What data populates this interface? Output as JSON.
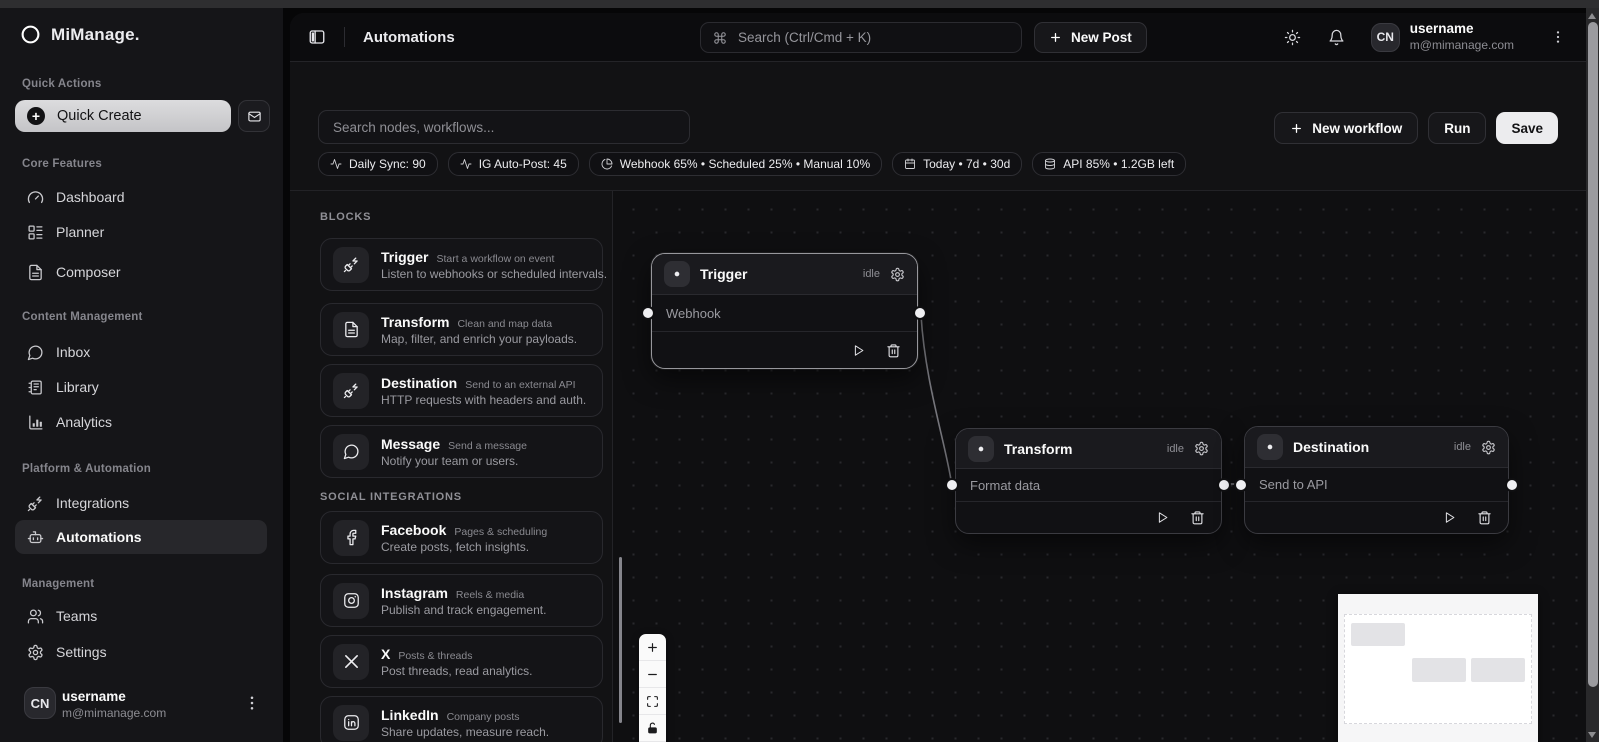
{
  "sidebar": {
    "logo_text": "MiManage.",
    "sections": {
      "quick_actions": "Quick Actions",
      "core_features": "Core Features",
      "content_management": "Content Management",
      "platform_automation": "Platform & Automation",
      "management": "Management"
    },
    "quick_create_label": "Quick Create",
    "items": {
      "dashboard": "Dashboard",
      "planner": "Planner",
      "composer": "Composer",
      "inbox": "Inbox",
      "library": "Library",
      "analytics": "Analytics",
      "integrations": "Integrations",
      "automations": "Automations",
      "teams": "Teams",
      "settings": "Settings"
    },
    "user": {
      "initials": "CN",
      "name": "username",
      "email": "m@mimanage.com"
    }
  },
  "header": {
    "title": "Automations",
    "search_placeholder": "Search (Ctrl/Cmd + K)",
    "new_post_label": "New Post",
    "user": {
      "initials": "CN",
      "name": "username",
      "email": "m@mimanage.com"
    }
  },
  "toolbar": {
    "search_placeholder": "Search nodes, workflows...",
    "badges": [
      {
        "icon": "activity-icon",
        "label": "Daily Sync: 90"
      },
      {
        "icon": "activity-icon",
        "label": "IG Auto-Post: 45"
      },
      {
        "icon": "pie-chart-icon",
        "label": "Webhook 65% • Scheduled 25% • Manual 10%"
      },
      {
        "icon": "calendar-icon",
        "label": "Today • 7d • 30d"
      },
      {
        "icon": "database-icon",
        "label": "API 85% • 1.2GB left"
      }
    ],
    "new_workflow_label": "New workflow",
    "run_label": "Run",
    "save_label": "Save"
  },
  "blocks_panel": {
    "blocks_heading": "BLOCKS",
    "social_heading": "SOCIAL INTEGRATIONS",
    "blocks": [
      {
        "icon": "plug-icon",
        "title": "Trigger",
        "subtitle": "Start a workflow on event",
        "description": "Listen to webhooks or scheduled intervals."
      },
      {
        "icon": "file-text-icon",
        "title": "Transform",
        "subtitle": "Clean and map data",
        "description": "Map, filter, and enrich your payloads."
      },
      {
        "icon": "plug-icon",
        "title": "Destination",
        "subtitle": "Send to an external API",
        "description": "HTTP requests with headers and auth."
      },
      {
        "icon": "message-circle-icon",
        "title": "Message",
        "subtitle": "Send a message",
        "description": "Notify your team or users."
      }
    ],
    "social": [
      {
        "icon": "facebook-icon",
        "title": "Facebook",
        "subtitle": "Pages & scheduling",
        "description": "Create posts, fetch insights."
      },
      {
        "icon": "instagram-icon",
        "title": "Instagram",
        "subtitle": "Reels & media",
        "description": "Publish and track engagement."
      },
      {
        "icon": "x-logo-icon",
        "title": "X",
        "subtitle": "Posts & threads",
        "description": "Post threads, read analytics."
      },
      {
        "icon": "linkedin-icon",
        "title": "LinkedIn",
        "subtitle": "Company posts",
        "description": "Share updates, measure reach."
      }
    ]
  },
  "canvas": {
    "nodes": [
      {
        "title": "Trigger",
        "status": "idle",
        "label": "Webhook"
      },
      {
        "title": "Transform",
        "status": "idle",
        "label": "Format data"
      },
      {
        "title": "Destination",
        "status": "idle",
        "label": "Send to API"
      }
    ]
  },
  "colors": {
    "save_button_bg": "#ececee",
    "selected_item_bg": "#27272b",
    "node_selected_border": "#97979c",
    "canvas_background": "#0f0f11",
    "sidebar_background": "#151518"
  }
}
